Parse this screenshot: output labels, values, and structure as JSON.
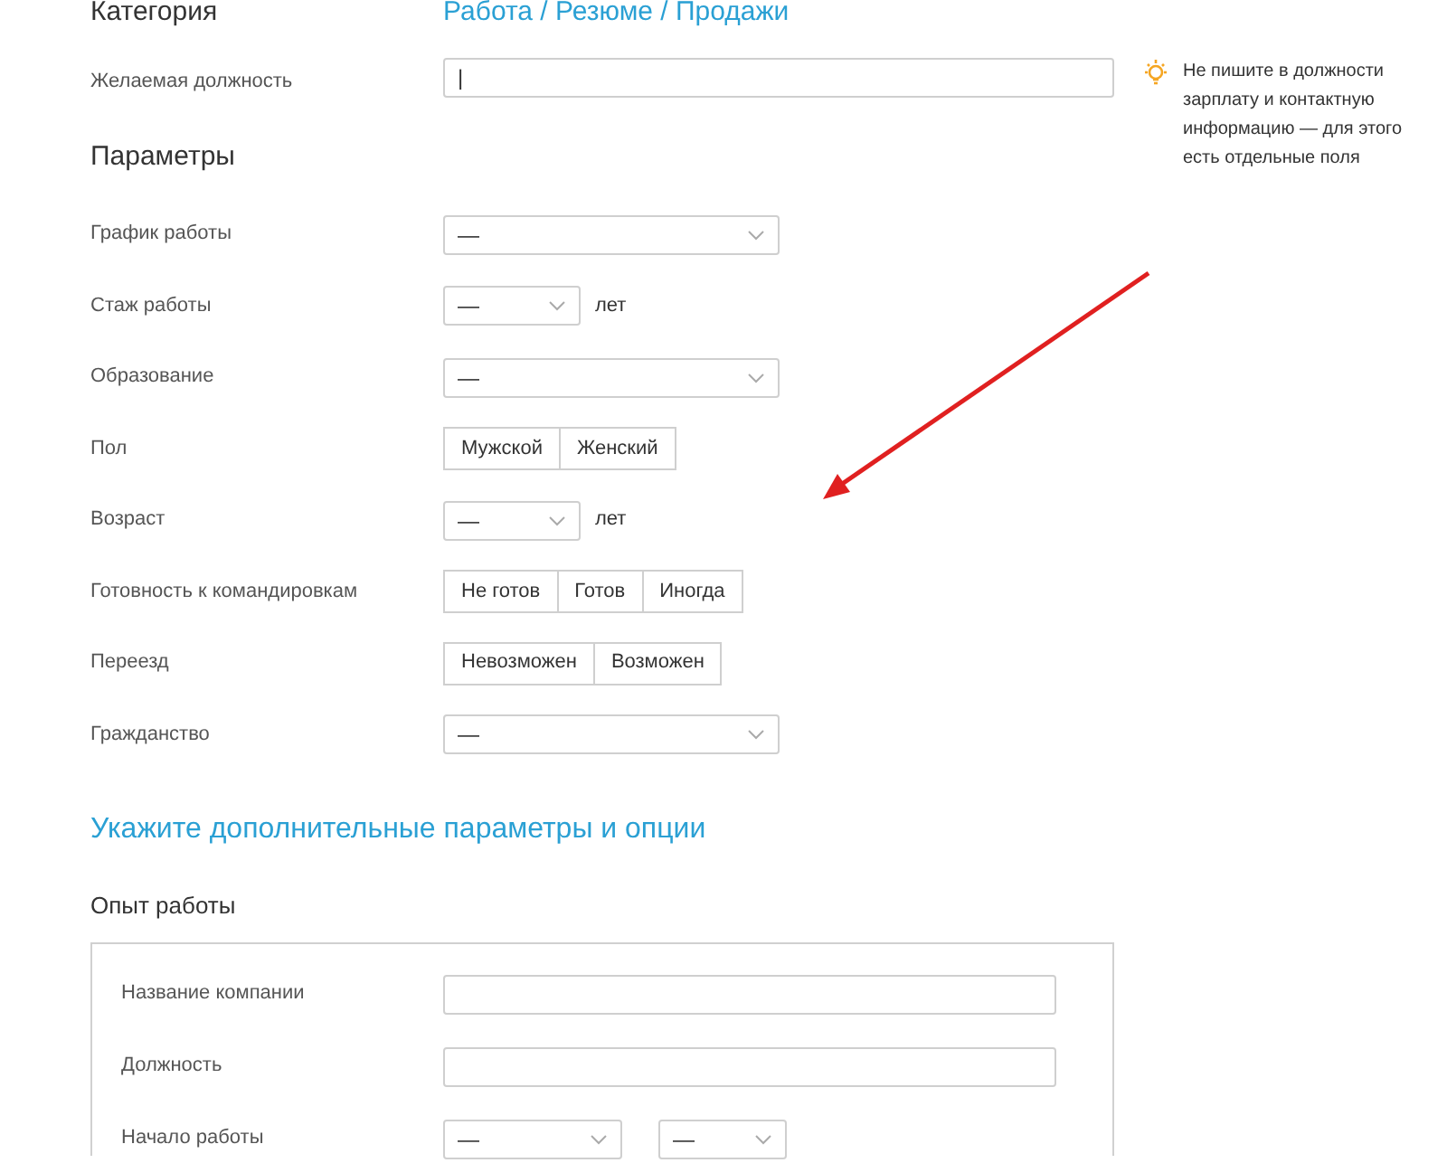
{
  "category": {
    "label": "Категория",
    "value": "Работа / Резюме / Продажи"
  },
  "position": {
    "label": "Желаемая должность",
    "value": "|"
  },
  "hint": {
    "text": "Не пишите в должности зарплату и контактную информацию — для этого есть отдельные поля"
  },
  "params_heading": "Параметры",
  "params": [
    {
      "kind": "select",
      "label": "График работы",
      "value": "—"
    },
    {
      "kind": "select_unit",
      "label": "Стаж работы",
      "value": "—",
      "unit": "лет"
    },
    {
      "kind": "select",
      "label": "Образование",
      "value": "—"
    },
    {
      "kind": "segmented",
      "label": "Пол",
      "options": [
        {
          "label": "Мужской",
          "selected": false
        },
        {
          "label": "Женский",
          "selected": false
        }
      ]
    },
    {
      "kind": "select_unit",
      "label": "Возраст",
      "value": "—",
      "unit": "лет"
    },
    {
      "kind": "segmented",
      "label": "Готовность к командировкам",
      "options": [
        {
          "label": "Не готов",
          "selected": false
        },
        {
          "label": "Готов",
          "selected": false
        },
        {
          "label": "Иногда",
          "selected": false
        }
      ]
    },
    {
      "kind": "segmented",
      "label": "Переезд",
      "options": [
        {
          "label": "Невозможен",
          "selected": false
        },
        {
          "label": "Возможен",
          "selected": false
        }
      ]
    },
    {
      "kind": "select",
      "label": "Гражданство",
      "value": "—"
    }
  ],
  "extra_heading": "Укажите дополнительные параметры и опции",
  "experience": {
    "title": "Опыт работы",
    "fields": [
      {
        "kind": "input",
        "label": "Название компании"
      },
      {
        "kind": "input",
        "label": "Должность"
      },
      {
        "kind": "date",
        "label": "Начало работы",
        "values": [
          "—",
          "—"
        ]
      }
    ]
  }
}
